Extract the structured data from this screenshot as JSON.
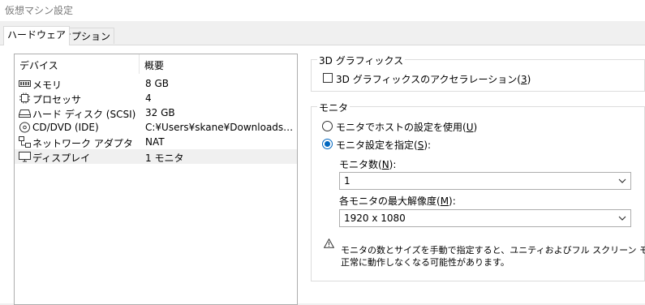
{
  "window": {
    "title": "仮想マシン設定"
  },
  "tabs": [
    {
      "label": "ハードウェア",
      "active": true
    },
    {
      "label": "オプション",
      "active": false
    }
  ],
  "device_list": {
    "columns": [
      "デバイス",
      "概要"
    ],
    "rows": [
      {
        "icon": "memory-icon",
        "name": "メモリ",
        "value": "8 GB"
      },
      {
        "icon": "processor-icon",
        "name": "プロセッサ",
        "value": "4"
      },
      {
        "icon": "hard-disk-icon",
        "name": "ハード ディスク (SCSI)",
        "value": "32 GB"
      },
      {
        "icon": "cd-dvd-icon",
        "name": "CD/DVD (IDE)",
        "value": "C:¥Users¥skane¥Downloads¥ref..."
      },
      {
        "icon": "network-adapter-icon",
        "name": "ネットワーク アダプタ",
        "value": "NAT"
      },
      {
        "icon": "display-icon",
        "name": "ディスプレイ",
        "value": "1 モニタ",
        "selected": true
      }
    ]
  },
  "graphics3d": {
    "legend": "3D グラフィックス",
    "accel_label": "3D グラフィックスのアクセラレーション(",
    "accel_key": "3",
    "accel_suffix": ")",
    "accel_checked": false
  },
  "monitor": {
    "legend": "モニタ",
    "use_host_label": "モニタでホストの設定を使用(",
    "use_host_key": "U",
    "use_host_suffix": ")",
    "specify_label": "モニタ設定を指定(",
    "specify_key": "S",
    "specify_suffix": "):",
    "selected": "specify",
    "count_label": "モニタ数(",
    "count_key": "N",
    "count_suffix": "):",
    "count_value": "1",
    "maxres_label": "各モニタの最大解像度(",
    "maxres_key": "M",
    "maxres_suffix": "):",
    "maxres_value": "1920 x 1080",
    "warning_line1": "モニタの数とサイズを手動で指定すると、ユニティおよびフル スクリーン モードが",
    "warning_line2": "正常に動作しなくなる可能性があります。"
  }
}
